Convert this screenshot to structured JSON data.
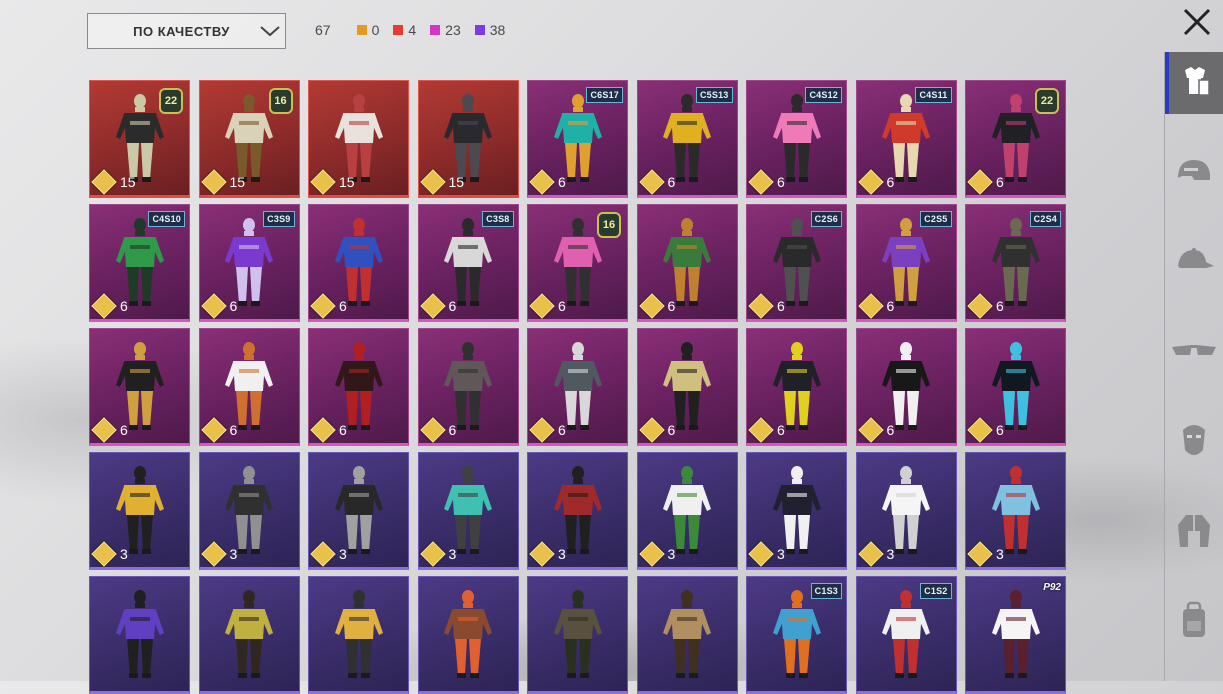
{
  "filter": {
    "sort_label": "ПО КАЧЕСТВУ"
  },
  "counts": {
    "total": "67",
    "tiers": [
      {
        "color": "#e39a1f",
        "value": "0"
      },
      {
        "color": "#e83b35",
        "value": "4"
      },
      {
        "color": "#d534c4",
        "value": "23"
      },
      {
        "color": "#7b3be0",
        "value": "38"
      }
    ]
  },
  "items": [
    {
      "rarity": "red",
      "cost": "15",
      "badge": "22",
      "badge_type": "num",
      "outfit": "dark-cloak"
    },
    {
      "rarity": "red",
      "cost": "15",
      "badge": "16",
      "badge_type": "num",
      "outfit": "gold-hood"
    },
    {
      "rarity": "red",
      "cost": "15",
      "badge": "",
      "badge_type": "",
      "outfit": "white-armor"
    },
    {
      "rarity": "red",
      "cost": "15",
      "badge": "",
      "badge_type": "",
      "outfit": "black-suit"
    },
    {
      "rarity": "pink",
      "cost": "6",
      "badge": "C6S17",
      "badge_type": "season",
      "outfit": "teal-jacket"
    },
    {
      "rarity": "pink",
      "cost": "6",
      "badge": "C5S13",
      "badge_type": "season",
      "outfit": "yellow-armor"
    },
    {
      "rarity": "pink",
      "cost": "6",
      "badge": "C4S12",
      "badge_type": "season",
      "outfit": "pink-outfit"
    },
    {
      "rarity": "pink",
      "cost": "6",
      "badge": "C4S11",
      "badge_type": "season",
      "outfit": "red-robe"
    },
    {
      "rarity": "pink",
      "cost": "6",
      "badge": "22",
      "badge_type": "num",
      "outfit": "dark-dress"
    },
    {
      "rarity": "pink",
      "cost": "6",
      "badge": "C4S10",
      "badge_type": "season",
      "outfit": "green-cape"
    },
    {
      "rarity": "pink",
      "cost": "6",
      "badge": "C3S9",
      "badge_type": "season",
      "outfit": "purple-coat"
    },
    {
      "rarity": "pink",
      "cost": "6",
      "badge": "",
      "badge_type": "",
      "outfit": "red-blue-armor"
    },
    {
      "rarity": "pink",
      "cost": "6",
      "badge": "C3S8",
      "badge_type": "season",
      "outfit": "grey-suit"
    },
    {
      "rarity": "pink",
      "cost": "6",
      "badge": "16",
      "badge_type": "num",
      "outfit": "pink-hood"
    },
    {
      "rarity": "pink",
      "cost": "6",
      "badge": "",
      "badge_type": "",
      "outfit": "green-coat"
    },
    {
      "rarity": "pink",
      "cost": "6",
      "badge": "C2S6",
      "badge_type": "season",
      "outfit": "black-coat"
    },
    {
      "rarity": "pink",
      "cost": "6",
      "badge": "C2S5",
      "badge_type": "season",
      "outfit": "purple-gold"
    },
    {
      "rarity": "pink",
      "cost": "6",
      "badge": "C2S4",
      "badge_type": "season",
      "outfit": "dark-suit"
    },
    {
      "rarity": "pink",
      "cost": "6",
      "badge": "",
      "badge_type": "",
      "outfit": "black-gold"
    },
    {
      "rarity": "pink",
      "cost": "6",
      "badge": "",
      "badge_type": "",
      "outfit": "white-fur"
    },
    {
      "rarity": "pink",
      "cost": "6",
      "badge": "",
      "badge_type": "",
      "outfit": "red-coat"
    },
    {
      "rarity": "pink",
      "cost": "6",
      "badge": "",
      "badge_type": "",
      "outfit": "grey-coat"
    },
    {
      "rarity": "pink",
      "cost": "6",
      "badge": "",
      "badge_type": "",
      "outfit": "long-coat"
    },
    {
      "rarity": "pink",
      "cost": "6",
      "badge": "",
      "badge_type": "",
      "outfit": "gold-vest"
    },
    {
      "rarity": "pink",
      "cost": "6",
      "badge": "",
      "badge_type": "",
      "outfit": "black-yellow"
    },
    {
      "rarity": "pink",
      "cost": "6",
      "badge": "",
      "badge_type": "",
      "outfit": "tux"
    },
    {
      "rarity": "pink",
      "cost": "6",
      "badge": "",
      "badge_type": "",
      "outfit": "neon-suit"
    },
    {
      "rarity": "purple",
      "cost": "3",
      "badge": "",
      "badge_type": "",
      "outfit": "yellow-top"
    },
    {
      "rarity": "purple",
      "cost": "3",
      "badge": "",
      "badge_type": "",
      "outfit": "black-armor"
    },
    {
      "rarity": "purple",
      "cost": "3",
      "badge": "",
      "badge_type": "",
      "outfit": "vest-suit"
    },
    {
      "rarity": "purple",
      "cost": "3",
      "badge": "",
      "badge_type": "",
      "outfit": "teal-armor"
    },
    {
      "rarity": "purple",
      "cost": "3",
      "badge": "",
      "badge_type": "",
      "outfit": "red-armor"
    },
    {
      "rarity": "purple",
      "cost": "3",
      "badge": "",
      "badge_type": "",
      "outfit": "white-track"
    },
    {
      "rarity": "purple",
      "cost": "3",
      "badge": "",
      "badge_type": "",
      "outfit": "black-white"
    },
    {
      "rarity": "purple",
      "cost": "3",
      "badge": "",
      "badge_type": "",
      "outfit": "white-suit"
    },
    {
      "rarity": "purple",
      "cost": "3",
      "badge": "",
      "badge_type": "",
      "outfit": "cyan-red"
    },
    {
      "rarity": "purple",
      "cost": "",
      "badge": "",
      "badge_type": "",
      "outfit": "violet-jacket"
    },
    {
      "rarity": "purple",
      "cost": "",
      "badge": "",
      "badge_type": "",
      "outfit": "olive-vest"
    },
    {
      "rarity": "purple",
      "cost": "",
      "badge": "",
      "badge_type": "",
      "outfit": "yellow-jacket"
    },
    {
      "rarity": "purple",
      "cost": "",
      "badge": "",
      "badge_type": "",
      "outfit": "brown-coat"
    },
    {
      "rarity": "purple",
      "cost": "",
      "badge": "",
      "badge_type": "",
      "outfit": "camo-armor"
    },
    {
      "rarity": "purple",
      "cost": "",
      "badge": "",
      "badge_type": "",
      "outfit": "khaki-outfit"
    },
    {
      "rarity": "purple",
      "cost": "",
      "badge": "C1S3",
      "badge_type": "season",
      "outfit": "orange-pants"
    },
    {
      "rarity": "purple",
      "cost": "",
      "badge": "C1S2",
      "badge_type": "season",
      "outfit": "white-red"
    },
    {
      "rarity": "purple",
      "cost": "",
      "badge": "P92",
      "badge_type": "tag",
      "outfit": "white-robe"
    }
  ],
  "sidebar": [
    {
      "icon": "outfit-icon",
      "active": true
    },
    {
      "icon": "helmet-icon",
      "active": false
    },
    {
      "icon": "cap-icon",
      "active": false
    },
    {
      "icon": "glasses-icon",
      "active": false
    },
    {
      "icon": "mask-icon",
      "active": false
    },
    {
      "icon": "jacket-icon",
      "active": false
    },
    {
      "icon": "backpack-icon",
      "active": false
    }
  ],
  "palette": {
    "outfit-colors": {
      "dark-cloak": [
        "#2b2b2b",
        "#c9c9a8"
      ],
      "gold-hood": [
        "#d9d2b8",
        "#7a5a2a"
      ],
      "white-armor": [
        "#e8e2dc",
        "#b94040"
      ],
      "black-suit": [
        "#2a2a2e",
        "#4a4a50"
      ],
      "teal-jacket": [
        "#1fb0a8",
        "#e0a030"
      ],
      "yellow-armor": [
        "#e0b020",
        "#2a2a2a"
      ],
      "pink-outfit": [
        "#f07ab8",
        "#2a2a2a"
      ],
      "red-robe": [
        "#d03a2a",
        "#e8d8b0"
      ],
      "dark-dress": [
        "#202025",
        "#c04070"
      ],
      "green-cape": [
        "#2e9a4a",
        "#203a28"
      ],
      "purple-coat": [
        "#7a3ad0",
        "#d0c0f0"
      ],
      "red-blue-armor": [
        "#3050c0",
        "#c03030"
      ],
      "grey-suit": [
        "#d8d8d8",
        "#2a2a2a"
      ],
      "pink-hood": [
        "#e060b0",
        "#303030"
      ],
      "green-coat": [
        "#3a7a3a",
        "#c08030"
      ],
      "black-coat": [
        "#2a2a2a",
        "#505050"
      ],
      "purple-gold": [
        "#7a40c0",
        "#d0a040"
      ],
      "dark-suit": [
        "#303030",
        "#6a6a50"
      ],
      "black-gold": [
        "#202020",
        "#d0a040"
      ],
      "white-fur": [
        "#f0f0f0",
        "#d07030"
      ],
      "red-coat": [
        "#301818",
        "#b02020"
      ],
      "grey-coat": [
        "#605858",
        "#303030"
      ],
      "long-coat": [
        "#505860",
        "#d8d8d8"
      ],
      "gold-vest": [
        "#d0c080",
        "#202020"
      ],
      "black-yellow": [
        "#202028",
        "#e0d020"
      ],
      "tux": [
        "#181818",
        "#f0f0f0"
      ],
      "neon-suit": [
        "#101820",
        "#40c0e0"
      ],
      "yellow-top": [
        "#e0b030",
        "#202020"
      ],
      "black-armor": [
        "#303030",
        "#909090"
      ],
      "vest-suit": [
        "#282828",
        "#a0a0a0"
      ],
      "teal-armor": [
        "#40c0b0",
        "#404040"
      ],
      "red-armor": [
        "#a02a2a",
        "#202020"
      ],
      "white-track": [
        "#f0f0f0",
        "#3a8a3a"
      ],
      "black-white": [
        "#202030",
        "#f0f0f0"
      ],
      "white-suit": [
        "#f5f5f5",
        "#d0d0d0"
      ],
      "cyan-red": [
        "#80c0e0",
        "#c03030"
      ],
      "violet-jacket": [
        "#6040c0",
        "#202020"
      ],
      "olive-vest": [
        "#c0b040",
        "#302820"
      ],
      "yellow-jacket": [
        "#e0b040",
        "#303030"
      ],
      "brown-coat": [
        "#8a4a30",
        "#e06030"
      ],
      "camo-armor": [
        "#5a5040",
        "#2a3020"
      ],
      "khaki-outfit": [
        "#b09060",
        "#403020"
      ],
      "orange-pants": [
        "#40a0d0",
        "#e07020"
      ],
      "white-red": [
        "#f0f0f0",
        "#c03030"
      ],
      "white-robe": [
        "#f5f5f5",
        "#5a2030"
      ]
    }
  }
}
